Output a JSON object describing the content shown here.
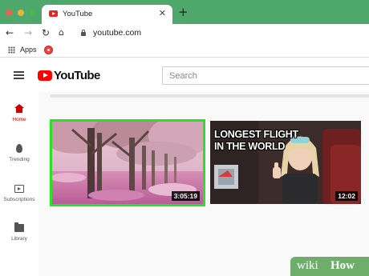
{
  "browser": {
    "tab_title": "YouTube",
    "tab_close": "✕",
    "new_tab": "+",
    "url": "youtube.com",
    "nav": {
      "back": "←",
      "forward": "→",
      "reload": "↻",
      "home": "⌂"
    },
    "bookmarks": {
      "apps_label": "Apps"
    },
    "colors": {
      "tabbar": "#4ea86c"
    }
  },
  "youtube": {
    "logo_text": "YouTube",
    "search_placeholder": "Search",
    "sidebar": {
      "items": [
        {
          "label": "Home",
          "icon": "home-icon",
          "active": true
        },
        {
          "label": "Trending",
          "icon": "flame-icon",
          "active": false
        },
        {
          "label": "Subscriptions",
          "icon": "subscriptions-icon",
          "active": false
        },
        {
          "label": "Library",
          "icon": "library-icon",
          "active": false
        }
      ]
    },
    "videos": [
      {
        "duration": "3:05:19",
        "thumbnail": "cherry-blossom-trees",
        "highlighted": true
      },
      {
        "duration": "12:02",
        "thumbnail_text": "LONGEST FLIGHT IN THE WORLD",
        "thumbnail": "woman-in-airplane-seat"
      }
    ],
    "colors": {
      "brand": "#ff0000",
      "highlight": "#27e227"
    }
  },
  "watermark": {
    "wiki": "wiki",
    "how": "How"
  }
}
